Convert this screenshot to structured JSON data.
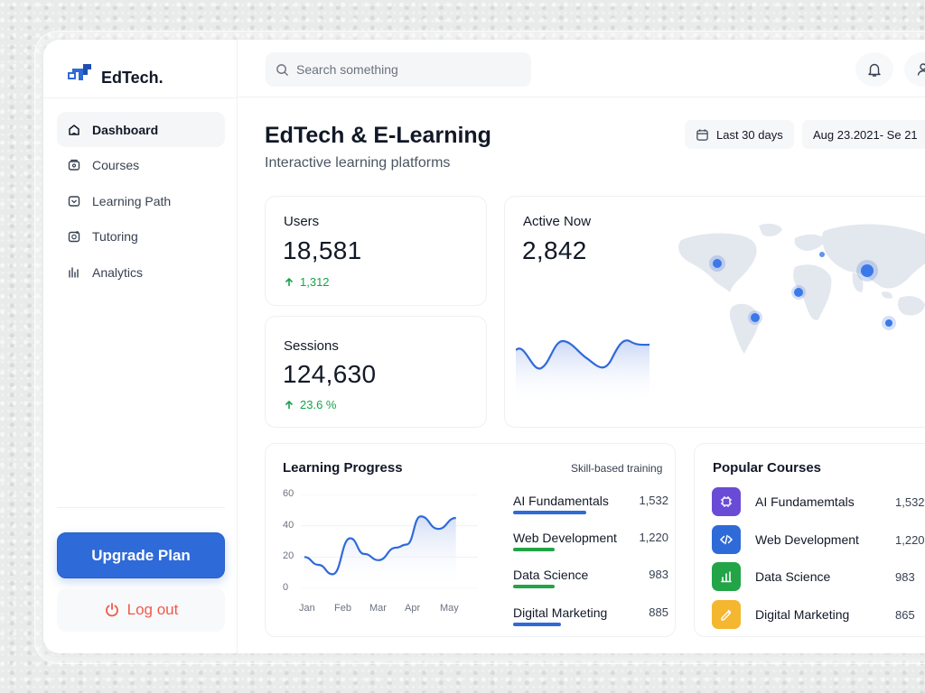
{
  "brand": {
    "name": "EdTech."
  },
  "nav": [
    {
      "label": "Dashboard",
      "icon": "home-icon",
      "active": true
    },
    {
      "label": "Courses",
      "icon": "courses-icon",
      "active": false
    },
    {
      "label": "Learning Path",
      "icon": "learning-path-icon",
      "active": false
    },
    {
      "label": "Tutoring",
      "icon": "tutoring-icon",
      "active": false
    },
    {
      "label": "Analytics",
      "icon": "analytics-icon",
      "active": false
    }
  ],
  "sidebar": {
    "upgrade_label": "Upgrade Plan",
    "logout_label": "Log out"
  },
  "search": {
    "placeholder": "Search something"
  },
  "header": {
    "title": "EdTech & E-Learning",
    "subtitle": "Interactive learning platforms",
    "range_label": "Last 30 days",
    "date_range": "Aug 23.2021- Se 21"
  },
  "stats": {
    "users": {
      "label": "Users",
      "value": "18,581",
      "change": "1,312"
    },
    "sessions": {
      "label": "Sessions",
      "value": "124,630",
      "change": "23.6 %"
    },
    "active": {
      "label": "Active Now",
      "value": "2,842"
    }
  },
  "learning_progress": {
    "title": "Learning Progress",
    "subtitle": "Skill-based training",
    "y_ticks": [
      "60",
      "40",
      "20",
      "0"
    ],
    "x_ticks": [
      "Jan",
      "Feb",
      "Mar",
      "Apr",
      "May"
    ]
  },
  "chart_data": {
    "type": "line",
    "title": "Learning Progress",
    "x": [
      "Jan",
      "Feb",
      "Mar",
      "Apr",
      "May"
    ],
    "ylim": [
      0,
      60
    ],
    "points": [
      [
        0.0,
        20
      ],
      [
        0.4,
        15
      ],
      [
        0.8,
        9
      ],
      [
        1.3,
        32
      ],
      [
        1.7,
        22
      ],
      [
        2.1,
        18
      ],
      [
        2.6,
        26
      ],
      [
        2.9,
        28
      ],
      [
        3.3,
        46
      ],
      [
        3.8,
        38
      ],
      [
        4.3,
        45
      ]
    ],
    "grid": true
  },
  "skills": [
    {
      "name": "AI Fundamentals",
      "value": "1,532",
      "progress": 0.47,
      "color": "#2f6ad9"
    },
    {
      "name": "Web Development",
      "value": "1,220",
      "progress": 0.27,
      "color": "#22a447"
    },
    {
      "name": "Data Science",
      "value": "983",
      "progress": 0.27,
      "color": "#22a447"
    },
    {
      "name": "Digital Marketing",
      "value": "885",
      "progress": 0.31,
      "color": "#2f6ad9"
    }
  ],
  "popular_courses": {
    "title": "Popular Courses",
    "items": [
      {
        "name": "AI Fundamemtals",
        "value": "1,532",
        "icon": "ai-chip-icon",
        "color": "#6a4bd6"
      },
      {
        "name": "Web Development",
        "value": "1,220",
        "icon": "code-icon",
        "color": "#2f6ad9"
      },
      {
        "name": "Data Science",
        "value": "983",
        "icon": "data-chart-icon",
        "color": "#22a447"
      },
      {
        "name": "Digital Marketing",
        "value": "865",
        "icon": "marketing-icon",
        "color": "#f5b630"
      }
    ]
  }
}
